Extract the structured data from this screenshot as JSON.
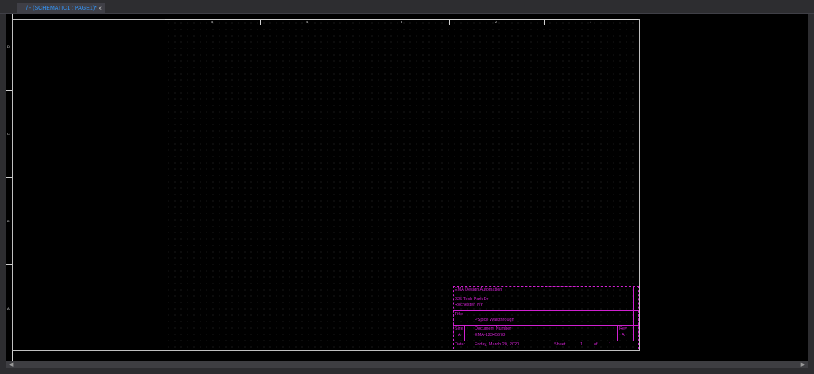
{
  "tab": {
    "label": "/ - (SCHEMATIC1 : PAGE1)*",
    "close_glyph": "×"
  },
  "rulers": {
    "column_labels": [
      "5",
      "4",
      "3",
      "2",
      "1"
    ],
    "row_labels": [
      "D",
      "C",
      "B",
      "A"
    ]
  },
  "title_block": {
    "company": "EMA Design Automation",
    "address1": "225 Tech Park Dr",
    "address2": "Rochester, NY",
    "title_caption": "Title",
    "title_value": "PSpice Walkthrough",
    "size_caption": "Size",
    "size_value": "A",
    "docnum_caption": "Document Number",
    "docnum_value": "EMA-12345678",
    "rev_caption": "Rev",
    "rev_value": "A",
    "date_caption": "Date:",
    "date_value": "Friday, March 20, 2020",
    "sheet_caption": "Sheet",
    "sheet_value": "1",
    "of_caption": "of",
    "of_value": "1"
  },
  "colors": {
    "accent": "#3399ff",
    "titleblock": "#d020d0",
    "canvas": "#000000",
    "chrome": "#2d2d30"
  },
  "scroll": {
    "left_glyph": "◀",
    "right_glyph": "▶"
  }
}
